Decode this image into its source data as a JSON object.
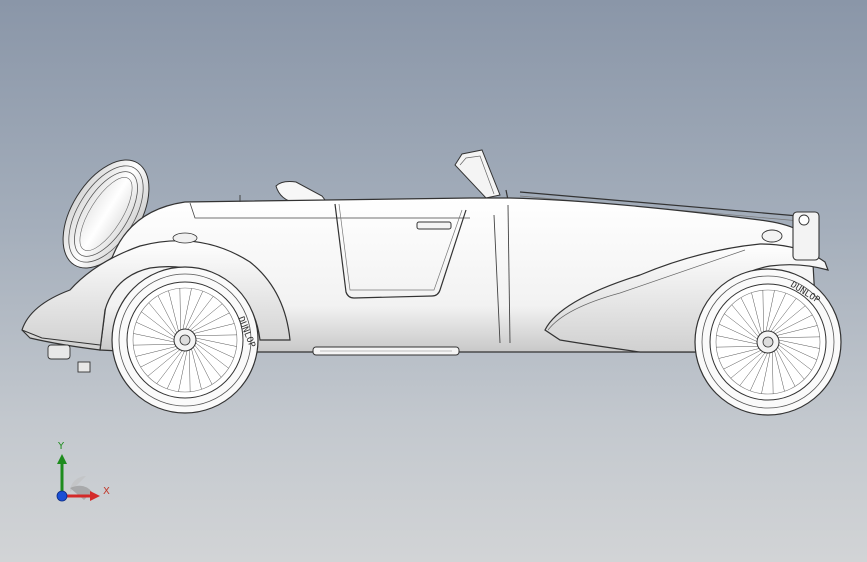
{
  "viewport": {
    "background_top": "#8a96a8",
    "background_bottom": "#d2d4d6"
  },
  "model": {
    "tire_brand": "DUNLOP"
  },
  "triad": {
    "y_label": "Y",
    "x_label": "X",
    "y_color": "#1e8c1e",
    "x_color": "#d42a2a",
    "z_color": "#1a4fd6"
  }
}
